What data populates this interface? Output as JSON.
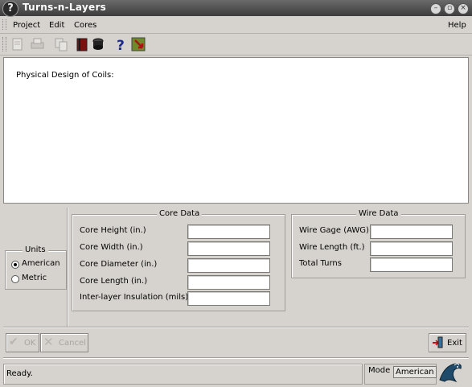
{
  "window": {
    "title": "Turns-n-Layers",
    "icon": "question-icon"
  },
  "menu": {
    "project": "Project",
    "edit": "Edit",
    "cores": "Cores",
    "help": "Help"
  },
  "toolbar": {
    "icons": [
      "new-icon",
      "print-icon",
      "copy-icon",
      "book-icon",
      "core-icon",
      "help-icon",
      "exit-icon"
    ]
  },
  "main": {
    "text": "Physical Design of Coils:"
  },
  "units": {
    "title": "Units",
    "american": "American",
    "metric": "Metric",
    "selected": "American"
  },
  "core_data": {
    "title": "Core Data",
    "height": "Core Height (in.)",
    "width": "Core Width (in.)",
    "diameter": "Core Diameter (in.)",
    "length": "Core Length (in.)",
    "insulation": "Inter-layer Insulation (mils)"
  },
  "wire_data": {
    "title": "Wire Data",
    "gage": "Wire Gage (AWG)",
    "length": "Wire Length (ft.)",
    "turns": "Total Turns"
  },
  "buttons": {
    "ok": "OK",
    "cancel": "Cancel",
    "exit": "Exit"
  },
  "status": {
    "text": "Ready.",
    "mode_label": "Mode",
    "mode_value": "American"
  }
}
